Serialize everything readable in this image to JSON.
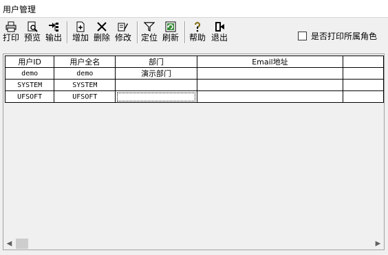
{
  "window": {
    "title": "用户管理"
  },
  "toolbar": {
    "buttons": [
      {
        "label": "打印",
        "icon": "printer-icon"
      },
      {
        "label": "预览",
        "icon": "preview-icon"
      },
      {
        "label": "输出",
        "icon": "export-icon"
      },
      {
        "label": "增加",
        "icon": "add-icon"
      },
      {
        "label": "删除",
        "icon": "delete-icon"
      },
      {
        "label": "修改",
        "icon": "edit-icon"
      },
      {
        "label": "定位",
        "icon": "filter-icon"
      },
      {
        "label": "刷新",
        "icon": "refresh-icon"
      },
      {
        "label": "帮助",
        "icon": "help-icon"
      },
      {
        "label": "退出",
        "icon": "exit-icon"
      }
    ],
    "print_roles_checkbox": {
      "label": "是否打印所属角色",
      "checked": false
    }
  },
  "grid": {
    "columns": [
      "用户ID",
      "用户全名",
      "部门",
      "Email地址",
      ""
    ],
    "rows": [
      [
        "demo",
        "demo",
        "演示部门",
        "",
        ""
      ],
      [
        "SYSTEM",
        "SYSTEM",
        "",
        "",
        ""
      ],
      [
        "UFSOFT",
        "UFSOFT",
        "",
        "",
        ""
      ]
    ]
  }
}
